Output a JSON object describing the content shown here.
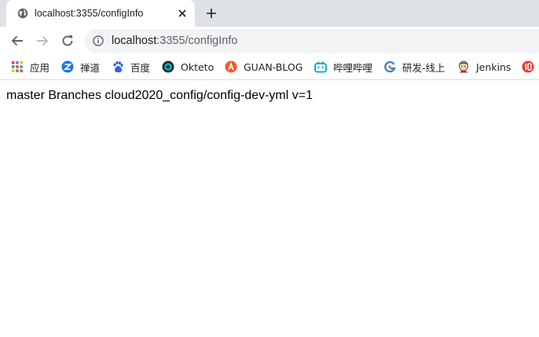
{
  "tab": {
    "title": "localhost:3355/configInfo"
  },
  "omnibox": {
    "host": "localhost",
    "path": ":3355/configInfo"
  },
  "bookmarks": [
    {
      "label": "应用",
      "icon": "apps-grid-icon"
    },
    {
      "label": "禅道",
      "icon": "zentao-icon"
    },
    {
      "label": "百度",
      "icon": "baidu-paw-icon"
    },
    {
      "label": "Okteto",
      "icon": "okteto-icon"
    },
    {
      "label": "GUAN-BLOG",
      "icon": "guan-blog-icon"
    },
    {
      "label": "哔哩哔哩",
      "icon": "bilibili-icon"
    },
    {
      "label": "研发-线上",
      "icon": "dev-online-icon"
    },
    {
      "label": "Jenkins",
      "icon": "jenkins-icon"
    },
    {
      "label": "",
      "icon": "app-icon"
    }
  ],
  "page": {
    "text": "master Branches cloud2020_config/config-dev-yml v=1"
  },
  "colors": {
    "tabstrip": "#dee1e6",
    "omnibox": "#f1f3f4",
    "page": "#ffffff"
  }
}
